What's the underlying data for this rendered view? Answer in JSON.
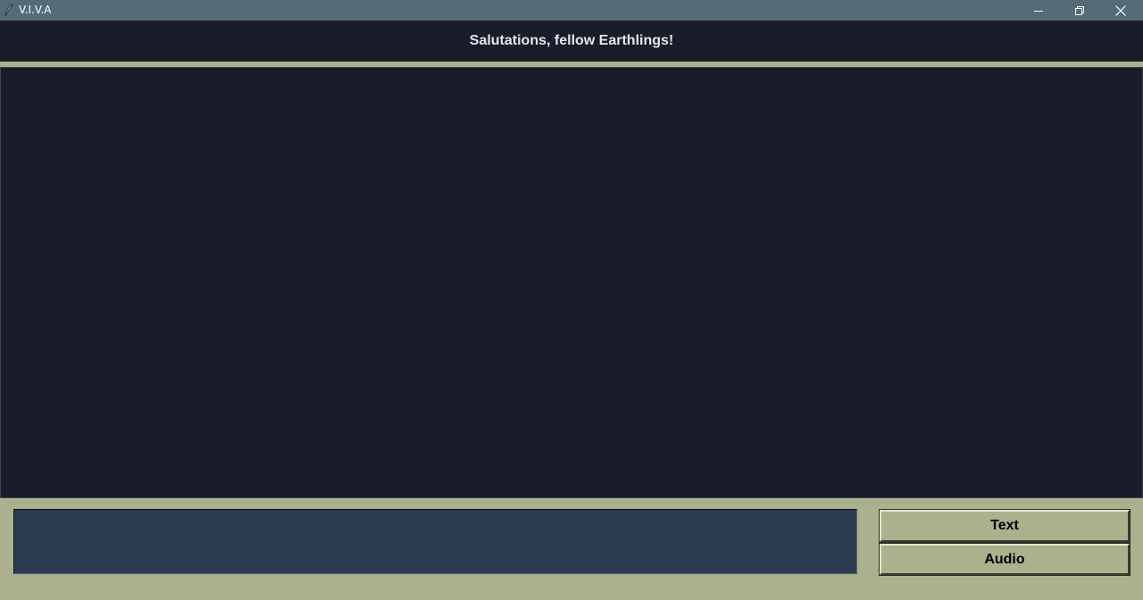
{
  "window": {
    "title": "V.I.V.A",
    "controls": {
      "minimize_icon": "minimize-icon",
      "maximize_icon": "restore-icon",
      "close_icon": "close-icon"
    }
  },
  "header": {
    "title": "Salutations, fellow Earthlings!"
  },
  "chat": {
    "messages": []
  },
  "input": {
    "value": "",
    "placeholder": ""
  },
  "buttons": {
    "text_label": "Text",
    "audio_label": "Audio"
  },
  "colors": {
    "titlebar": "#546b78",
    "panel_dark": "#181d29",
    "accent_olive": "#abb18d",
    "input_bg": "#2c3c50"
  }
}
